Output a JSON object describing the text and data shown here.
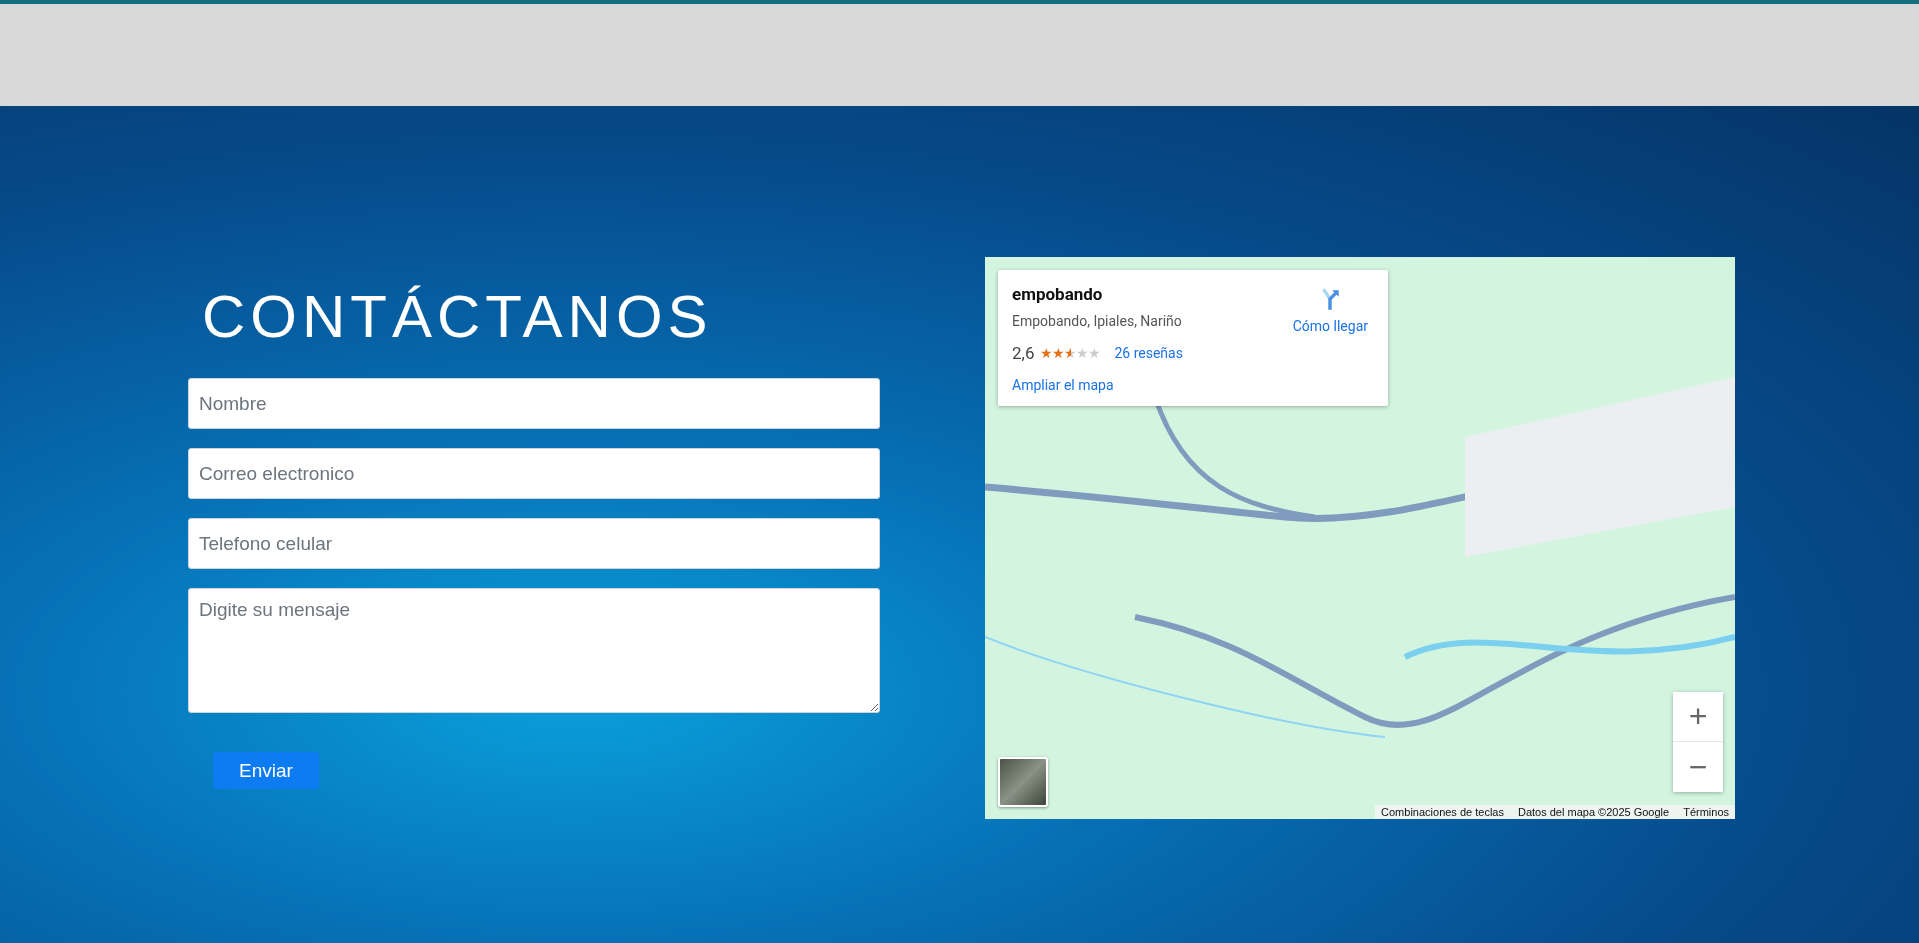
{
  "heading": "CONTÁCTANOS",
  "form": {
    "fields": [
      {
        "kind": "input",
        "placeholder": "Nombre"
      },
      {
        "kind": "input",
        "placeholder": "Correo electronico"
      },
      {
        "kind": "input",
        "placeholder": "Telefono celular"
      },
      {
        "kind": "textarea",
        "placeholder": "Digite su mensaje"
      }
    ],
    "submit": "Enviar"
  },
  "map": {
    "place": {
      "name": "empobando",
      "address": "Empobando, Ipiales, Nariño",
      "rating": "2,6",
      "stars": 2.6,
      "reviews": "26 reseñas",
      "directions": "Cómo llegar",
      "enlarge": "Ampliar el mapa"
    },
    "zoom_in": "+",
    "zoom_out": "−",
    "footer": [
      "Combinaciones de teclas",
      "Datos del mapa ©2025 Google",
      "Términos"
    ]
  }
}
